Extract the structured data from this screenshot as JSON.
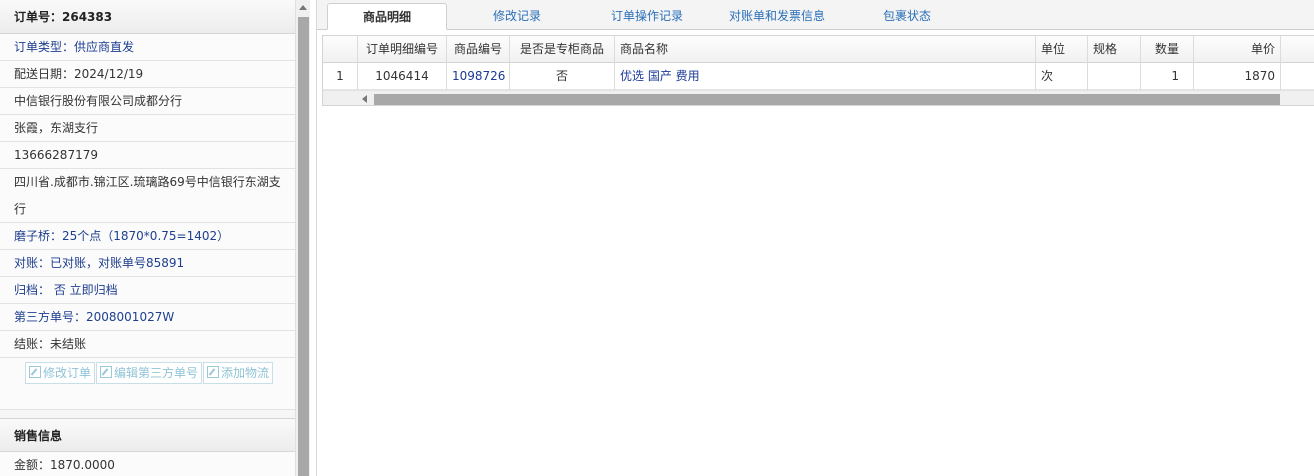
{
  "left": {
    "order_title": "订单号：264383",
    "rows": [
      "订单类型：供应商直发",
      "配送日期：2024/12/19",
      "中信银行股份有限公司成都分行",
      "张霞，东湖支行",
      "13666287179",
      "四川省.成都市.锦江区.琉璃路69号中信银行东湖支行",
      "磨子桥：25个点（1870*0.75=1402）",
      "对账：已对账，对账单号85891",
      "归档： 否 立即归档",
      "第三方单号：2008001027W",
      "结账：未结账"
    ],
    "buttons": [
      "修改订单",
      "编辑第三方单号",
      "添加物流"
    ],
    "sales_title": "销售信息",
    "amount": "金额：1870.0000"
  },
  "tabs": [
    "商品明细",
    "修改记录",
    "订单操作记录",
    "对账单和发票信息",
    "包裹状态"
  ],
  "active_tab": "商品明细",
  "grid": {
    "headers": [
      "",
      "订单明细编号",
      "商品编号",
      "是否是专柜商品",
      "商品名称",
      "单位",
      "规格",
      "数量",
      "单价"
    ],
    "rows": [
      [
        "1",
        "1046414",
        "1098726",
        "否",
        "优选 国产 费用",
        "次",
        "",
        "1",
        "1870"
      ]
    ]
  },
  "colors": {
    "blue_text": "#1e3f8f",
    "tab_link": "#2a6fb8",
    "button_text": "#8fc3d6"
  }
}
